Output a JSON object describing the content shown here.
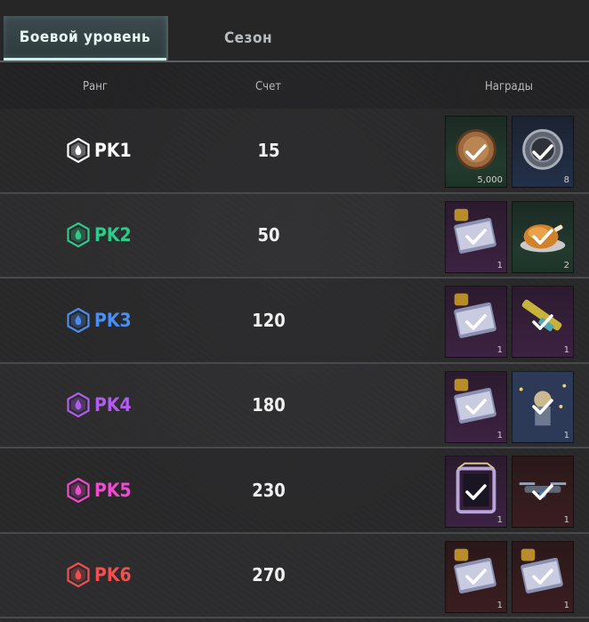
{
  "tabs": [
    {
      "label": "Боевой уровень",
      "active": true
    },
    {
      "label": "Сезон",
      "active": false
    }
  ],
  "header": {
    "rank": "Ранг",
    "score": "Счет",
    "rewards": "Награды"
  },
  "rows": [
    {
      "rank": "PK1",
      "color": "#ffffff",
      "score": "15",
      "rewards": [
        {
          "icon": "coin-icon",
          "qty": "5,000",
          "bg": "green"
        },
        {
          "icon": "silver-token-icon",
          "qty": "8",
          "bg": "navy"
        }
      ]
    },
    {
      "rank": "PK2",
      "color": "#2ec98b",
      "score": "50",
      "rewards": [
        {
          "icon": "crate-coupon-icon",
          "qty": "1",
          "bg": "purple"
        },
        {
          "icon": "roast-chicken-icon",
          "qty": "2",
          "bg": "green"
        }
      ]
    },
    {
      "rank": "PK3",
      "color": "#4a8ff0",
      "score": "120",
      "rewards": [
        {
          "icon": "crate-coupon-icon",
          "qty": "1",
          "bg": "purple"
        },
        {
          "icon": "weapon-skin-icon",
          "qty": "1",
          "bg": "purple"
        }
      ]
    },
    {
      "rank": "PK4",
      "color": "#b15cf0",
      "score": "180",
      "rewards": [
        {
          "icon": "crate-coupon-icon",
          "qty": "1",
          "bg": "purple"
        },
        {
          "icon": "lantern-emblem-icon",
          "qty": "1",
          "bg": "blue-dark"
        }
      ]
    },
    {
      "rank": "PK5",
      "color": "#f04bd0",
      "score": "230",
      "rewards": [
        {
          "icon": "avatar-frame-icon",
          "qty": "1",
          "bg": "purple"
        },
        {
          "icon": "drone-icon",
          "qty": "1",
          "bg": "red"
        }
      ]
    },
    {
      "rank": "PK6",
      "color": "#f05050",
      "score": "270",
      "rewards": [
        {
          "icon": "crate-coupon-icon",
          "qty": "1",
          "bg": "red"
        },
        {
          "icon": "crate-coupon-icon",
          "qty": "1",
          "bg": "red"
        }
      ]
    }
  ]
}
